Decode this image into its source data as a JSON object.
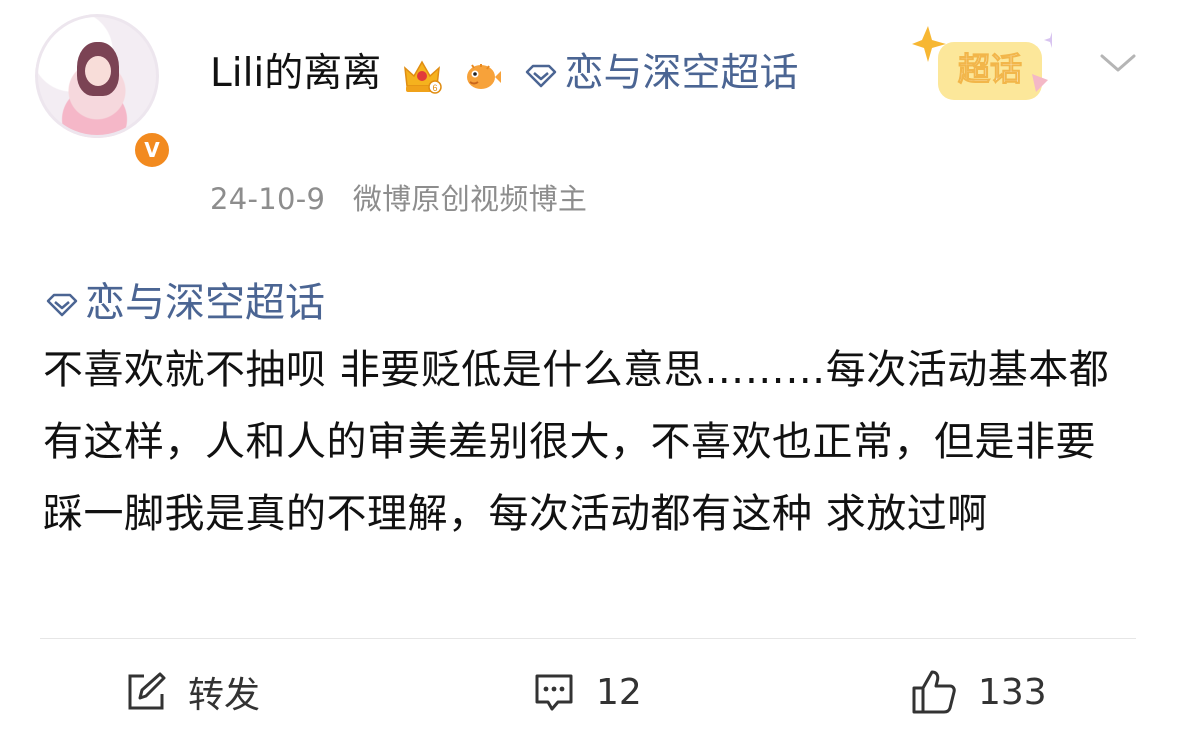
{
  "post": {
    "author": {
      "name": "Lili的离离",
      "avatar_icon": "anime-girl-avatar",
      "verified_icon": "verified-v-icon",
      "verified_mark": "V",
      "member_badge": "crown-level-6-icon",
      "fan_badge": "pufferfish-icon"
    },
    "topic_link": "恋与深空超话",
    "meta": {
      "date": "24-10-9",
      "source": "微博原创视频博主"
    },
    "supertopic_tag": "超话",
    "body": {
      "topic": "恋与深空超话",
      "text": "不喜欢就不抽呗 非要贬低是什么意思………每次活动基本都有这样，人和人的审美差别很大，不喜欢也正常，但是非要踩一脚我是真的不理解，每次活动都有这种 求放过啊"
    },
    "actions": {
      "repost_label": "转发",
      "comment_count": "12",
      "like_count": "133"
    },
    "colors": {
      "topic": "#4b6593",
      "meta": "#8d8d8d",
      "verified": "#f28a1f"
    }
  }
}
